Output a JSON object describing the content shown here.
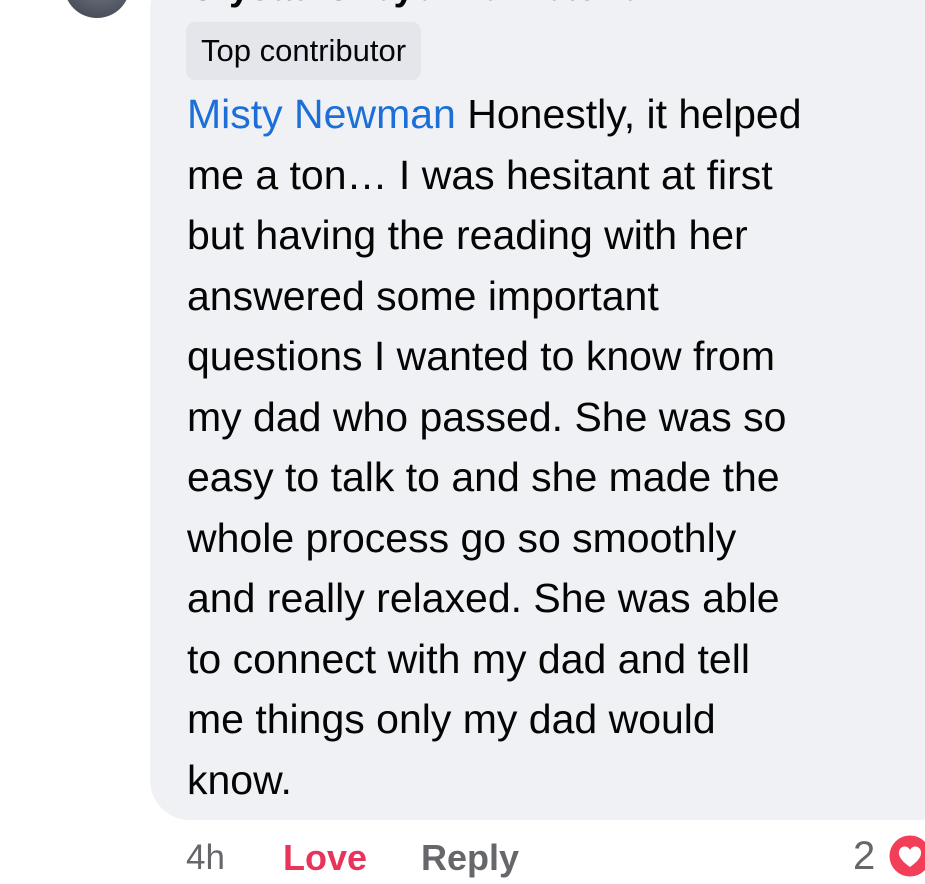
{
  "comment": {
    "author": "Crystal Cheyenne Fletcher",
    "badge": "Top contributor",
    "mention": "Misty Newman",
    "lines": [
      "Honestly, it helped",
      "me a ton… I was hesitant at first",
      "but having the reading with her",
      "answered some important",
      "questions I wanted to know from",
      "my dad who passed. She was so",
      "easy to talk to and she made the",
      "whole process go so smoothly",
      "and really relaxed. She was able",
      "to connect with my dad and tell",
      "me things only my dad would",
      "know."
    ]
  },
  "actions": {
    "time": "4h",
    "love_label": "Love",
    "reply_label": "Reply",
    "reaction_count": "2"
  },
  "icons": {
    "reaction": "heart-reaction-icon"
  },
  "colors": {
    "bubble": "#f0f1f4",
    "mention": "#1b6fd6",
    "love": "#e8335a",
    "secondary_text": "#65676b",
    "badge_bg": "#e4e6eb"
  }
}
